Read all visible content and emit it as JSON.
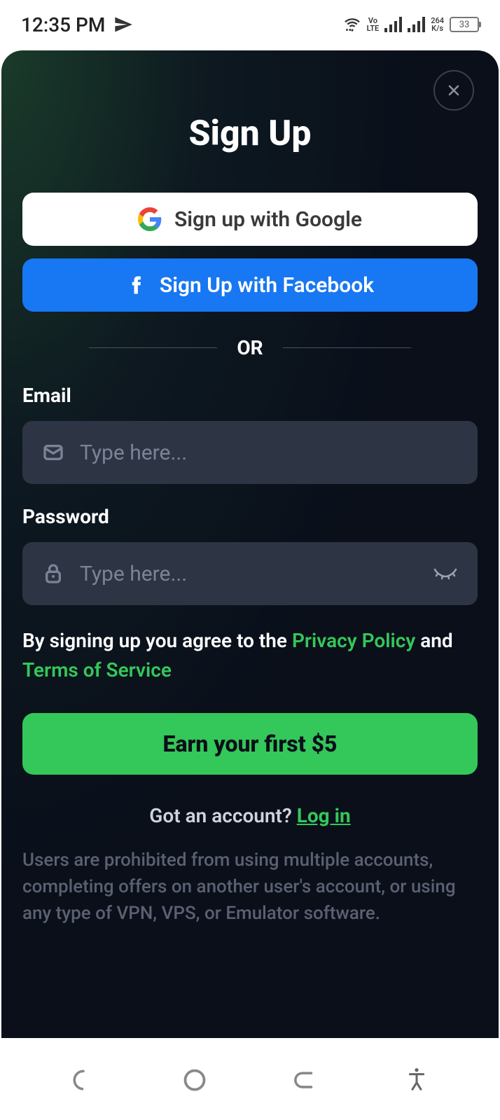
{
  "status_bar": {
    "time": "12:35 PM",
    "lte_top": "Vo",
    "lte_bottom": "LTE",
    "speed_top": "264",
    "speed_bottom": "K/s",
    "battery": "33"
  },
  "page": {
    "title": "Sign Up",
    "google_label": "Sign up with Google",
    "facebook_label": "Sign Up with Facebook",
    "divider": "OR",
    "email_label": "Email",
    "email_placeholder": "Type here...",
    "password_label": "Password",
    "password_placeholder": "Type here...",
    "agreement_prefix": "By signing up you agree to the ",
    "privacy_link": "Privacy Policy",
    "agreement_and": " and ",
    "terms_link": "Terms of Service",
    "primary_cta": "Earn your first $5",
    "login_prompt": "Got an account? ",
    "login_link": "Log in",
    "disclaimer": "Users are prohibited from using multiple accounts, completing offers on another user's account, or using any type of VPN, VPS, or Emulator software."
  }
}
